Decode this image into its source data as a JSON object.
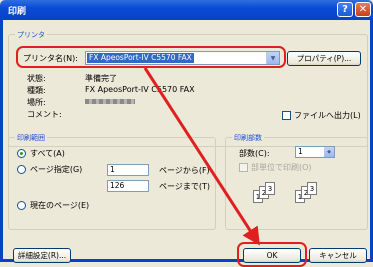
{
  "window": {
    "title": "印刷"
  },
  "printer_group": {
    "label": "プリンタ",
    "name_label": "プリンタ名(N):",
    "printer_selected": "FX ApeosPort-IV C5570 FAX",
    "properties_button": "プロパティ(P)...",
    "status_label": "状態:",
    "status_value": "準備完了",
    "type_label": "種類:",
    "type_value": "FX ApeosPort-IV C5570 FAX",
    "location_label": "場所:",
    "comment_label": "コメント:",
    "print_to_file_label": "ファイルへ出力(L)"
  },
  "range_group": {
    "label": "印刷範囲",
    "all_label": "すべて(A)",
    "pages_label": "ページ指定(G)",
    "from_value": "1",
    "to_value": "126",
    "from_suffix": "ページから(F)",
    "to_suffix": "ページまで(T)",
    "current_label": "現在のページ(E)",
    "selected": "all"
  },
  "copies_group": {
    "label": "印刷部数",
    "copies_label": "部数(C):",
    "copies_value": "1",
    "collate_label": "部単位で印刷(O)",
    "collate_icons": [
      "1",
      "2",
      "3",
      "1",
      "2",
      "3"
    ]
  },
  "footer": {
    "advanced_button": "詳細設定(R)...",
    "ok_button": "OK",
    "cancel_button": "キャンセル"
  },
  "annotation": {
    "color": "#e02020"
  }
}
